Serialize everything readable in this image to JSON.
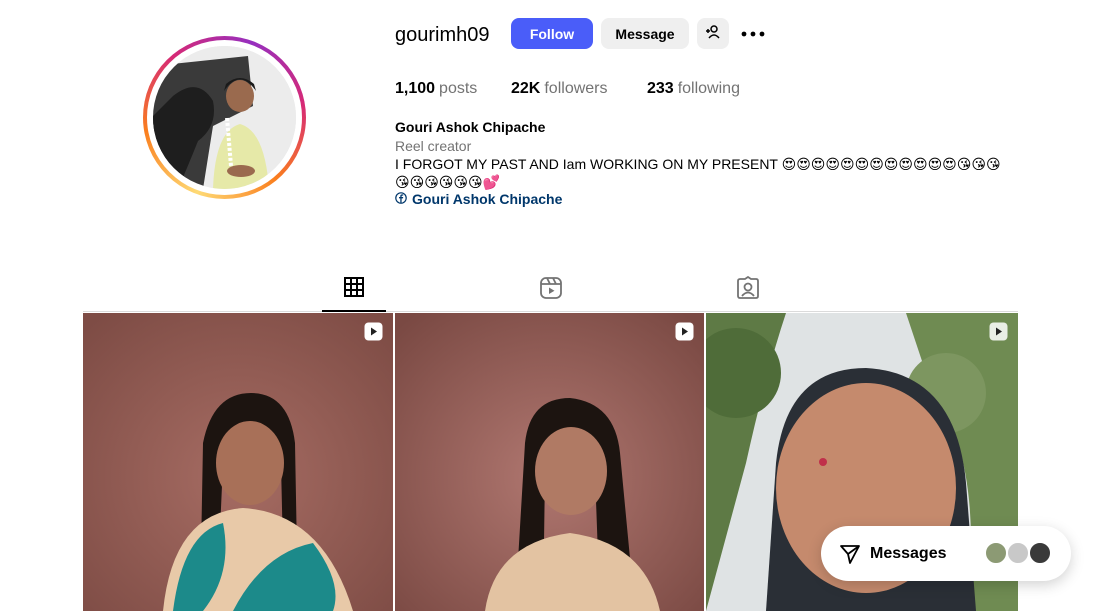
{
  "profile": {
    "username": "gourimh09",
    "follow_label": "Follow",
    "message_label": "Message",
    "stats": {
      "posts_count": "1,100",
      "posts_label": "posts",
      "followers_count": "22K",
      "followers_label": "followers",
      "following_count": "233",
      "following_label": "following"
    },
    "full_name": "Gouri Ashok Chipache",
    "category": "Reel creator",
    "bio": "I FORGOT MY PAST AND Iam WORKING ON MY PRESENT 😍😍😍😍😍😍😍😍😍😍😍😍😘😘😘😘😘😘😘😘😘💕",
    "link_text": "Gouri Ashok Chipache"
  },
  "tabs": [
    {
      "name": "posts",
      "icon": "grid-icon",
      "active": true
    },
    {
      "name": "reels",
      "icon": "reels-icon",
      "active": false
    },
    {
      "name": "tagged",
      "icon": "tagged-icon",
      "active": false
    }
  ],
  "posts": [
    {
      "type": "reel",
      "icon": "reel-icon"
    },
    {
      "type": "reel",
      "icon": "reel-icon"
    },
    {
      "type": "reel",
      "icon": "reel-icon"
    }
  ],
  "messages_widget": {
    "label": "Messages"
  },
  "colors": {
    "follow_button": "#4a5df9",
    "secondary_button": "#efefef",
    "link": "#00376b",
    "muted_text": "#737373"
  }
}
